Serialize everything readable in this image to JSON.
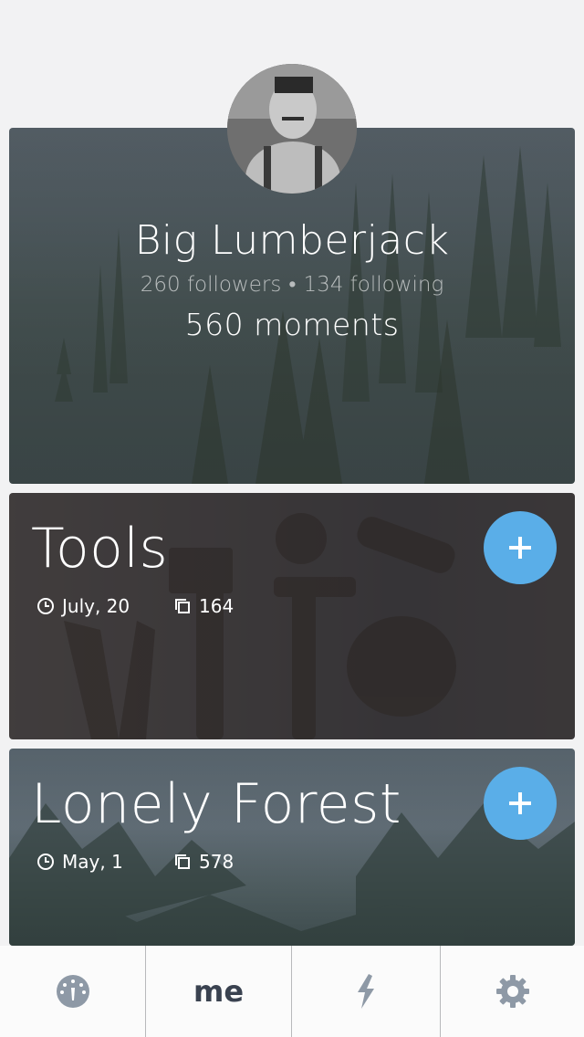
{
  "profile": {
    "name": "Big Lumberjack",
    "followers": "260 followers",
    "separator": "•",
    "following": "134 following",
    "moments": "560 moments"
  },
  "moments": [
    {
      "title": "Tools",
      "date": "July, 20",
      "count": "164",
      "add_icon": "plus-icon"
    },
    {
      "title": "Lonely Forest",
      "date": "May, 1",
      "count": "578",
      "add_icon": "plus-icon"
    }
  ],
  "tabbar": {
    "tabs": [
      {
        "icon": "dashboard-icon"
      },
      {
        "label": "me"
      },
      {
        "icon": "lightning-icon"
      },
      {
        "icon": "gear-icon"
      }
    ]
  },
  "colors": {
    "accent": "#5aaee8",
    "background": "#f2f2f3",
    "tab_icon": "#8e99a6",
    "tab_label": "#3a4250"
  }
}
